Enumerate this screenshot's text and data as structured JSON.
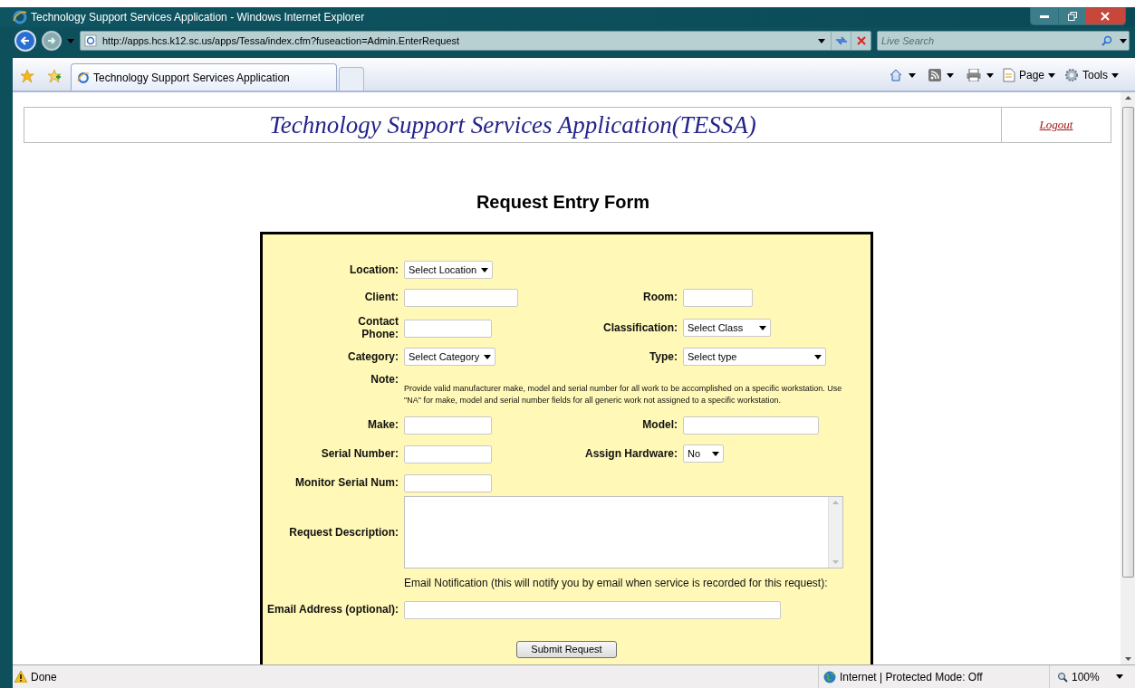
{
  "window": {
    "title": "Technology Support Services Application - Windows Internet Explorer"
  },
  "address_bar": {
    "url": "http://apps.hcs.k12.sc.us/apps/Tessa/index.cfm?fuseaction=Admin.EnterRequest",
    "search_placeholder": "Live Search"
  },
  "tabs": [
    {
      "label": "Technology Support Services Application",
      "selected": true
    }
  ],
  "command_bar": {
    "page": "Page",
    "tools": "Tools"
  },
  "header": {
    "title": "Technology Support Services Application(TESSA)",
    "logout": "Logout"
  },
  "form": {
    "title": "Request Entry Form",
    "rows": [
      {
        "kind": "fields",
        "fields": [
          {
            "label": "Location:",
            "kind": "select",
            "value": "Select Location"
          }
        ]
      },
      {
        "kind": "fields",
        "fields": [
          {
            "label": "Client:",
            "kind": "text"
          },
          {
            "label": "Room:",
            "kind": "text"
          }
        ]
      },
      {
        "kind": "fields",
        "fields": [
          {
            "label": "Contact Phone:",
            "kind": "text"
          },
          {
            "label": "Classification:",
            "kind": "select",
            "value": "Select Class"
          }
        ]
      },
      {
        "kind": "fields",
        "fields": [
          {
            "label": "Category:",
            "kind": "select",
            "value": "Select Category"
          },
          {
            "label": "Type:",
            "kind": "select",
            "value": "Select type"
          }
        ]
      },
      {
        "kind": "note",
        "label": "Note:",
        "text": "Provide valid manufacturer make, model and serial number for all work to be accomplished on a specific workstation. Use \"NA\" for make, model and serial number fields for all generic work not assigned to a specific workstation."
      },
      {
        "kind": "fields",
        "fields": [
          {
            "label": "Make:",
            "kind": "text"
          },
          {
            "label": "Model:",
            "kind": "text"
          }
        ]
      },
      {
        "kind": "fields",
        "fields": [
          {
            "label": "Serial Number:",
            "kind": "text"
          },
          {
            "label": "Assign Hardware:",
            "kind": "select",
            "value": "No"
          }
        ]
      },
      {
        "kind": "fields",
        "fields": [
          {
            "label": "Monitor Serial Num:",
            "kind": "text"
          }
        ]
      },
      {
        "kind": "textarea",
        "label": "Request Description:"
      },
      {
        "kind": "notice",
        "text": "Email Notification (this will notify you by email when service is recorded for this request):"
      },
      {
        "kind": "fields",
        "fields": [
          {
            "label": "Email Address (optional):",
            "kind": "text"
          }
        ]
      }
    ],
    "submit": "Submit Request"
  },
  "status_bar": {
    "status": "Done",
    "zone": "Internet | Protected Mode: Off",
    "zoom": "100%"
  }
}
